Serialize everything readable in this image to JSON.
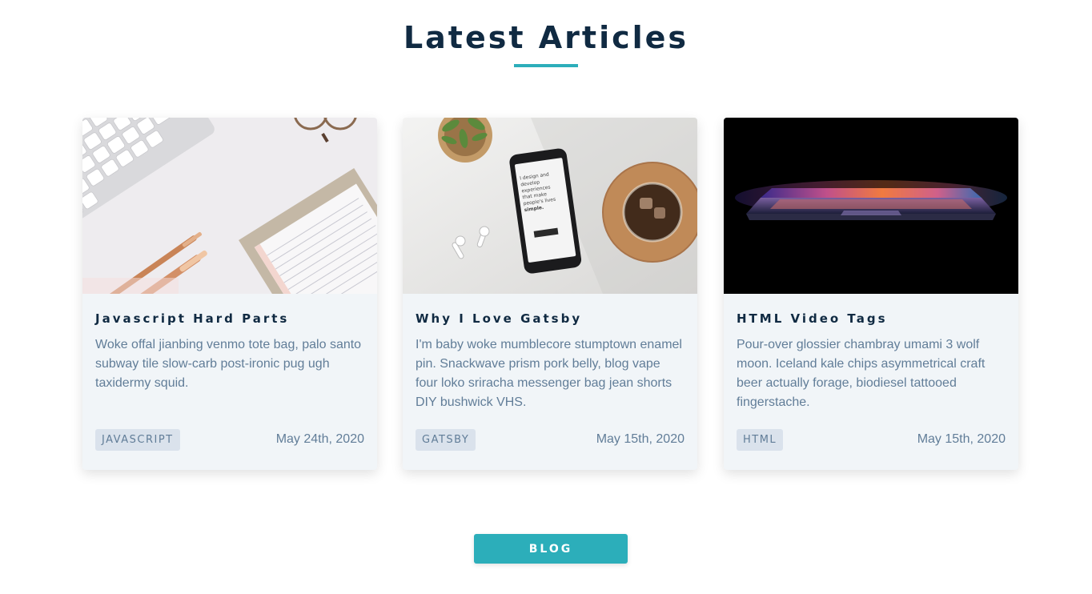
{
  "section": {
    "title": "Latest Articles"
  },
  "articles": [
    {
      "title": "Javascript Hard Parts",
      "excerpt": "Woke offal jianbing venmo tote bag, palo santo subway tile slow-carb post-ironic pug ugh taxidermy squid.",
      "category": "javascript",
      "date": "May 24th, 2020"
    },
    {
      "title": "Why I Love Gatsby",
      "excerpt": "I'm baby woke mumblecore stumptown enamel pin. Snackwave prism pork belly, blog vape four loko sriracha messenger bag jean shorts DIY bushwick VHS.",
      "category": "gatsby",
      "date": "May 15th, 2020"
    },
    {
      "title": "HTML Video Tags",
      "excerpt": "Pour-over glossier chambray umami 3 wolf moon. Iceland kale chips asymmetrical craft beer actually forage, biodiesel tattooed fingerstache.",
      "category": "html",
      "date": "May 15th, 2020"
    }
  ],
  "phone_screen_text": [
    "I design and",
    "develop",
    "experiences",
    "that make",
    "people's lives",
    "simple."
  ],
  "blog_button": {
    "label": "BLOG"
  },
  "colors": {
    "primary": "#2caeba",
    "heading": "#102a42",
    "text": "#617d98",
    "card_bg": "#f1f5f8",
    "tag_bg": "#dae2ec"
  }
}
